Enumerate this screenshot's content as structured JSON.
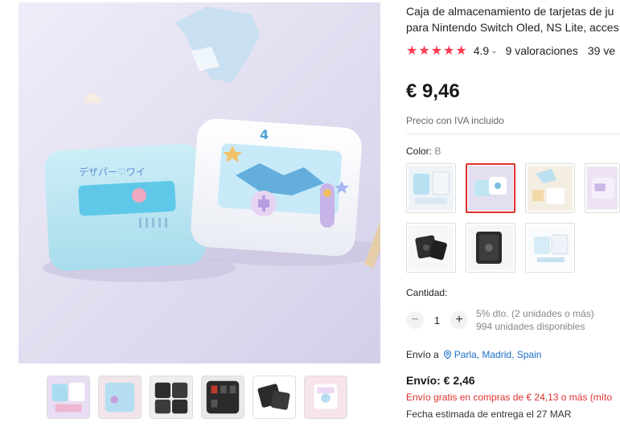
{
  "product": {
    "title_line1": "Caja de almacenamiento de tarjetas de ju",
    "title_line2": "para Nintendo Switch Oled, NS Lite, acces",
    "rating": "4.9",
    "rating_caret": "⌄",
    "reviews": "9 valoraciones",
    "sold": "39 ve",
    "stars": [
      "★",
      "★",
      "★",
      "★",
      "★"
    ],
    "price": "€ 9,46",
    "vat_note": "Precio con IVA incluido"
  },
  "color": {
    "label": "Color: ",
    "selected_value": "B",
    "swatches": [
      {
        "name": "A",
        "selected": false
      },
      {
        "name": "B",
        "selected": true
      },
      {
        "name": "C",
        "selected": false
      },
      {
        "name": "D",
        "selected": false
      },
      {
        "name": "E",
        "selected": false
      },
      {
        "name": "F",
        "selected": false
      },
      {
        "name": "G",
        "selected": false
      }
    ]
  },
  "quantity": {
    "label": "Cantidad:",
    "value": "1",
    "minus": "−",
    "plus": "+",
    "discount": "5% dto. (2 unidades o más)",
    "available": "994 unidades disponibles"
  },
  "shipping": {
    "ship_to_label": "Envío a",
    "location": "Parla, Madrid, Spain",
    "cost": "Envío: € 2,46",
    "free_note": "Envío gratis en compras de € 24,13 o más (míto",
    "delivery": "Fecha estimada de entrega el 27 MAR"
  },
  "gallery": {
    "thumb_count": 7
  },
  "colors": {
    "accent_red": "#e0302e",
    "star_red": "#fd384f",
    "link_blue": "#1a6fc9"
  }
}
